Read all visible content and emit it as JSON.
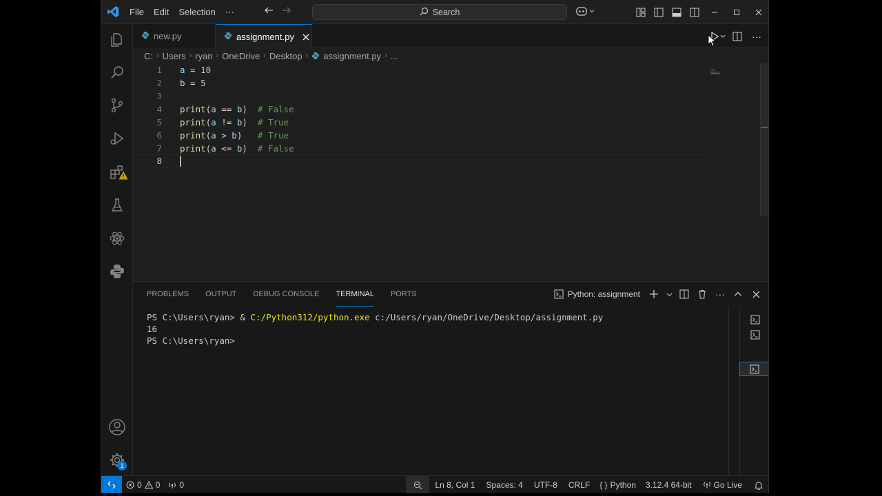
{
  "titlebar": {
    "menu": [
      "File",
      "Edit",
      "Selection",
      "···"
    ],
    "search_placeholder": "Search"
  },
  "tabs": [
    {
      "label": "new.py",
      "active": false
    },
    {
      "label": "assignment.py",
      "active": true
    }
  ],
  "breadcrumb": [
    "C:",
    "Users",
    "ryan",
    "OneDrive",
    "Desktop",
    "assignment.py",
    "..."
  ],
  "editor": {
    "lines": [
      {
        "num": "1",
        "text": "a = 10"
      },
      {
        "num": "2",
        "text": "b = 5"
      },
      {
        "num": "3",
        "text": ""
      },
      {
        "num": "4",
        "text": "print(a == b)  # False"
      },
      {
        "num": "5",
        "text": "print(a != b)  # True"
      },
      {
        "num": "6",
        "text": "print(a > b)   # True"
      },
      {
        "num": "7",
        "text": "print(a <= b)  # False"
      },
      {
        "num": "8",
        "text": ""
      }
    ],
    "current_line": 8
  },
  "panel": {
    "tabs": [
      "PROBLEMS",
      "OUTPUT",
      "DEBUG CONSOLE",
      "TERMINAL",
      "PORTS"
    ],
    "active_tab": "TERMINAL",
    "terminal_name": "Python: assignment",
    "terminal": {
      "line1_prompt": "PS C:\\Users\\ryan> ",
      "line1_amp": "& ",
      "line1_exe": "C:/Python312/python.exe",
      "line1_arg": " c:/Users/ryan/OneDrive/Desktop/assignment.py",
      "line2": "16",
      "line3": "PS C:\\Users\\ryan> "
    }
  },
  "statusbar": {
    "errors": "0",
    "warnings": "0",
    "ports": "0",
    "position": "Ln 8, Col 1",
    "spaces": "Spaces: 4",
    "encoding": "UTF-8",
    "eol": "CRLF",
    "language": "Python",
    "interpreter": "3.12.4 64-bit",
    "golive": "Go Live"
  },
  "activity": {
    "settings_badge": "1"
  },
  "colors": {
    "accent": "#0078d4",
    "editor_bg": "#1f1f1f",
    "comment": "#6a9955",
    "variable": "#9cdcfe",
    "number": "#b5cea8",
    "function": "#dcdcaa",
    "terminal_command": "#e5e510"
  }
}
